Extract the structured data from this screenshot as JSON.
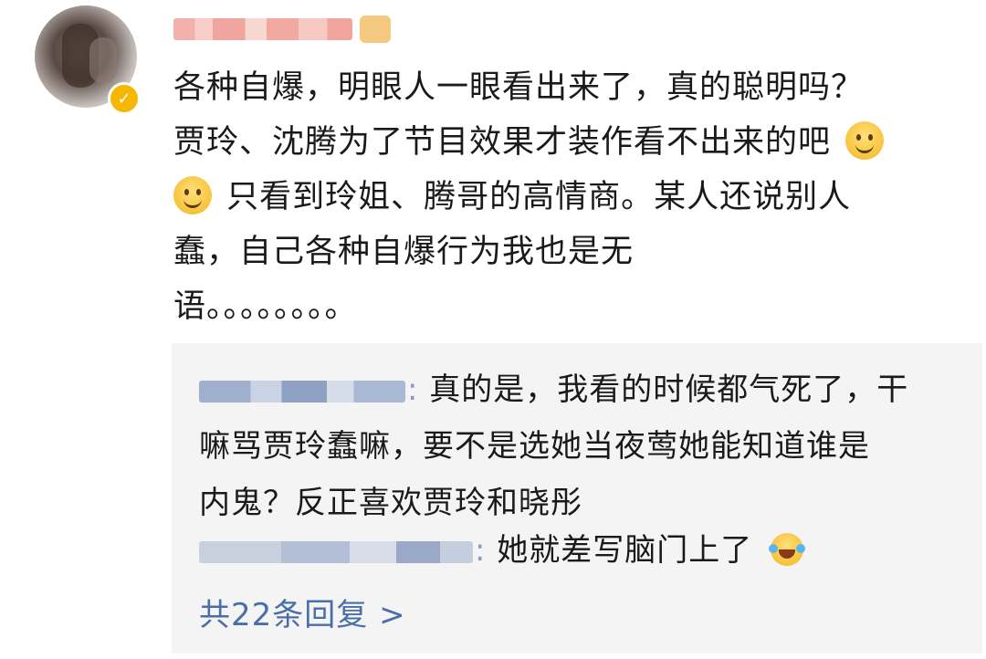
{
  "post": {
    "username": "",
    "verified": true,
    "comment_lines": [
      "各种自爆，明眼人一眼看出来了，真的聪明吗？",
      "贾玲、沈腾为了节目效果才装作看不出来的吧",
      "只看到玲姐、腾哥的高情商。某人还说别人",
      "蠢，自己各种自爆行为我也是无",
      "语。。。。。。。。"
    ]
  },
  "replies": [
    {
      "separator": ":",
      "lines": [
        "真的是，我看的时候都气死了，干",
        "嘛骂贾玲蠢嘛，要不是选她当夜莺她能知道谁是",
        "内鬼？反正喜欢贾玲和晓彤"
      ]
    },
    {
      "separator": ":",
      "text": "她就差写脑门上了"
    }
  ],
  "more_replies_label": "共22条回复 >",
  "icons": {
    "emoji_1": "smile-emoji-icon",
    "emoji_2": "smile-emoji-icon",
    "emoji_3": "laugh-cry-emoji-icon",
    "badge": "verified-badge-icon"
  },
  "colors": {
    "link": "#4a6fa8",
    "reply_bg": "#f4f4f4",
    "badge": "#f5b700"
  }
}
